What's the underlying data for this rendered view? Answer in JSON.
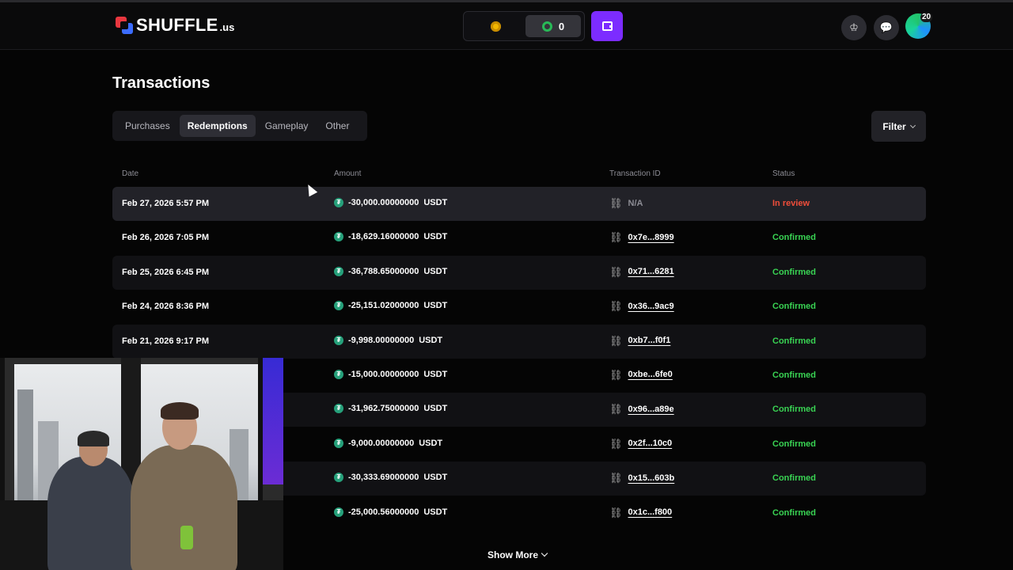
{
  "header": {
    "logo_text": "SHUFFLE",
    "logo_tld": ".us",
    "balance_value": "0",
    "notification_count": "20"
  },
  "page": {
    "title": "Transactions",
    "tabs": [
      {
        "label": "Purchases",
        "active": false
      },
      {
        "label": "Redemptions",
        "active": true
      },
      {
        "label": "Gameplay",
        "active": false
      },
      {
        "label": "Other",
        "active": false
      }
    ],
    "filter_label": "Filter",
    "columns": {
      "date": "Date",
      "amount": "Amount",
      "transaction_id": "Transaction ID",
      "status": "Status"
    },
    "rows": [
      {
        "date": "Feb 27, 2026 5:57 PM",
        "amount": "-30,000.00000000",
        "currency": "USDT",
        "tx": "N/A",
        "status": "In review"
      },
      {
        "date": "Feb 26, 2026 7:05 PM",
        "amount": "-18,629.16000000",
        "currency": "USDT",
        "tx": "0x7e...8999",
        "status": "Confirmed"
      },
      {
        "date": "Feb 25, 2026 6:45 PM",
        "amount": "-36,788.65000000",
        "currency": "USDT",
        "tx": "0x71...6281",
        "status": "Confirmed"
      },
      {
        "date": "Feb 24, 2026 8:36 PM",
        "amount": "-25,151.02000000",
        "currency": "USDT",
        "tx": "0x36...9ac9",
        "status": "Confirmed"
      },
      {
        "date": "Feb 21, 2026 9:17 PM",
        "amount": "-9,998.00000000",
        "currency": "USDT",
        "tx": "0xb7...f0f1",
        "status": "Confirmed"
      },
      {
        "date": "",
        "amount": "-15,000.00000000",
        "currency": "USDT",
        "tx": "0xbe...6fe0",
        "status": "Confirmed"
      },
      {
        "date": "",
        "amount": "-31,962.75000000",
        "currency": "USDT",
        "tx": "0x96...a89e",
        "status": "Confirmed"
      },
      {
        "date": "",
        "amount": "-9,000.00000000",
        "currency": "USDT",
        "tx": "0x2f...10c0",
        "status": "Confirmed"
      },
      {
        "date": "",
        "amount": "-30,333.69000000",
        "currency": "USDT",
        "tx": "0x15...603b",
        "status": "Confirmed"
      },
      {
        "date": "",
        "amount": "-25,000.56000000",
        "currency": "USDT",
        "tx": "0x1c...f800",
        "status": "Confirmed"
      }
    ],
    "show_more_label": "Show More"
  },
  "colors": {
    "accent": "#7c2cff",
    "confirmed": "#39d353",
    "in_review": "#ef4d3a",
    "tether": "#26a17b"
  }
}
